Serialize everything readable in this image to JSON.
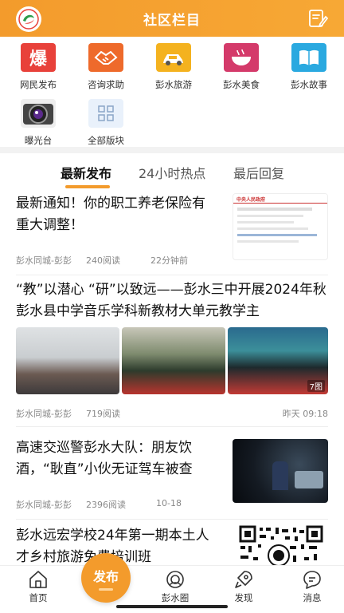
{
  "header": {
    "title": "社区栏目"
  },
  "categories": [
    {
      "label": "网民发布",
      "icon": "bao-icon",
      "glyph": "爆",
      "color": "#e8413a"
    },
    {
      "label": "咨询求助",
      "icon": "handshake-icon",
      "glyph": "",
      "color": "#ee6a2b"
    },
    {
      "label": "彭水旅游",
      "icon": "car-icon",
      "glyph": "",
      "color": "#f4b21f"
    },
    {
      "label": "彭水美食",
      "icon": "food-icon",
      "glyph": "",
      "color": "#d43a6a"
    },
    {
      "label": "彭水故事",
      "icon": "book-icon",
      "glyph": "",
      "color": "#2aa9e0"
    },
    {
      "label": "曝光台",
      "icon": "camera-icon",
      "glyph": "",
      "color": "#333333"
    },
    {
      "label": "全部版块",
      "icon": "grid-icon",
      "glyph": "",
      "color": "#e9f1fb"
    }
  ],
  "tabs": [
    {
      "label": "最新发布"
    },
    {
      "label": "24小时热点"
    },
    {
      "label": "最后回复"
    }
  ],
  "posts": [
    {
      "title": "最新通知！你的职工养老保险有重大调整！",
      "source": "彭水同城-彭彭",
      "reads": "240阅读",
      "time": "22分钟前"
    },
    {
      "title": "“教”以潜心 “研”以致远——彭水三中开展2024年秋彭水县中学音乐学科新教材大单元教学主",
      "source": "彭水同城-彭彭",
      "reads": "719阅读",
      "time": "昨天 09:18",
      "image_count": "7图"
    },
    {
      "title": "高速交巡警彭水大队：朋友饮酒，“耿直”小伙无证驾车被查",
      "source": "彭水同城-彭彭",
      "reads": "2396阅读",
      "time": "10-18"
    },
    {
      "title": "彭水远宏学校24年第一期本土人才乡村旅游免费培训班"
    }
  ],
  "thumb_doc": {
    "header": "中央人民政府"
  },
  "nav": [
    {
      "label": "首页"
    },
    {
      "label": "发布"
    },
    {
      "label": "彭水圈"
    },
    {
      "label": "发现"
    },
    {
      "label": "消息"
    }
  ]
}
